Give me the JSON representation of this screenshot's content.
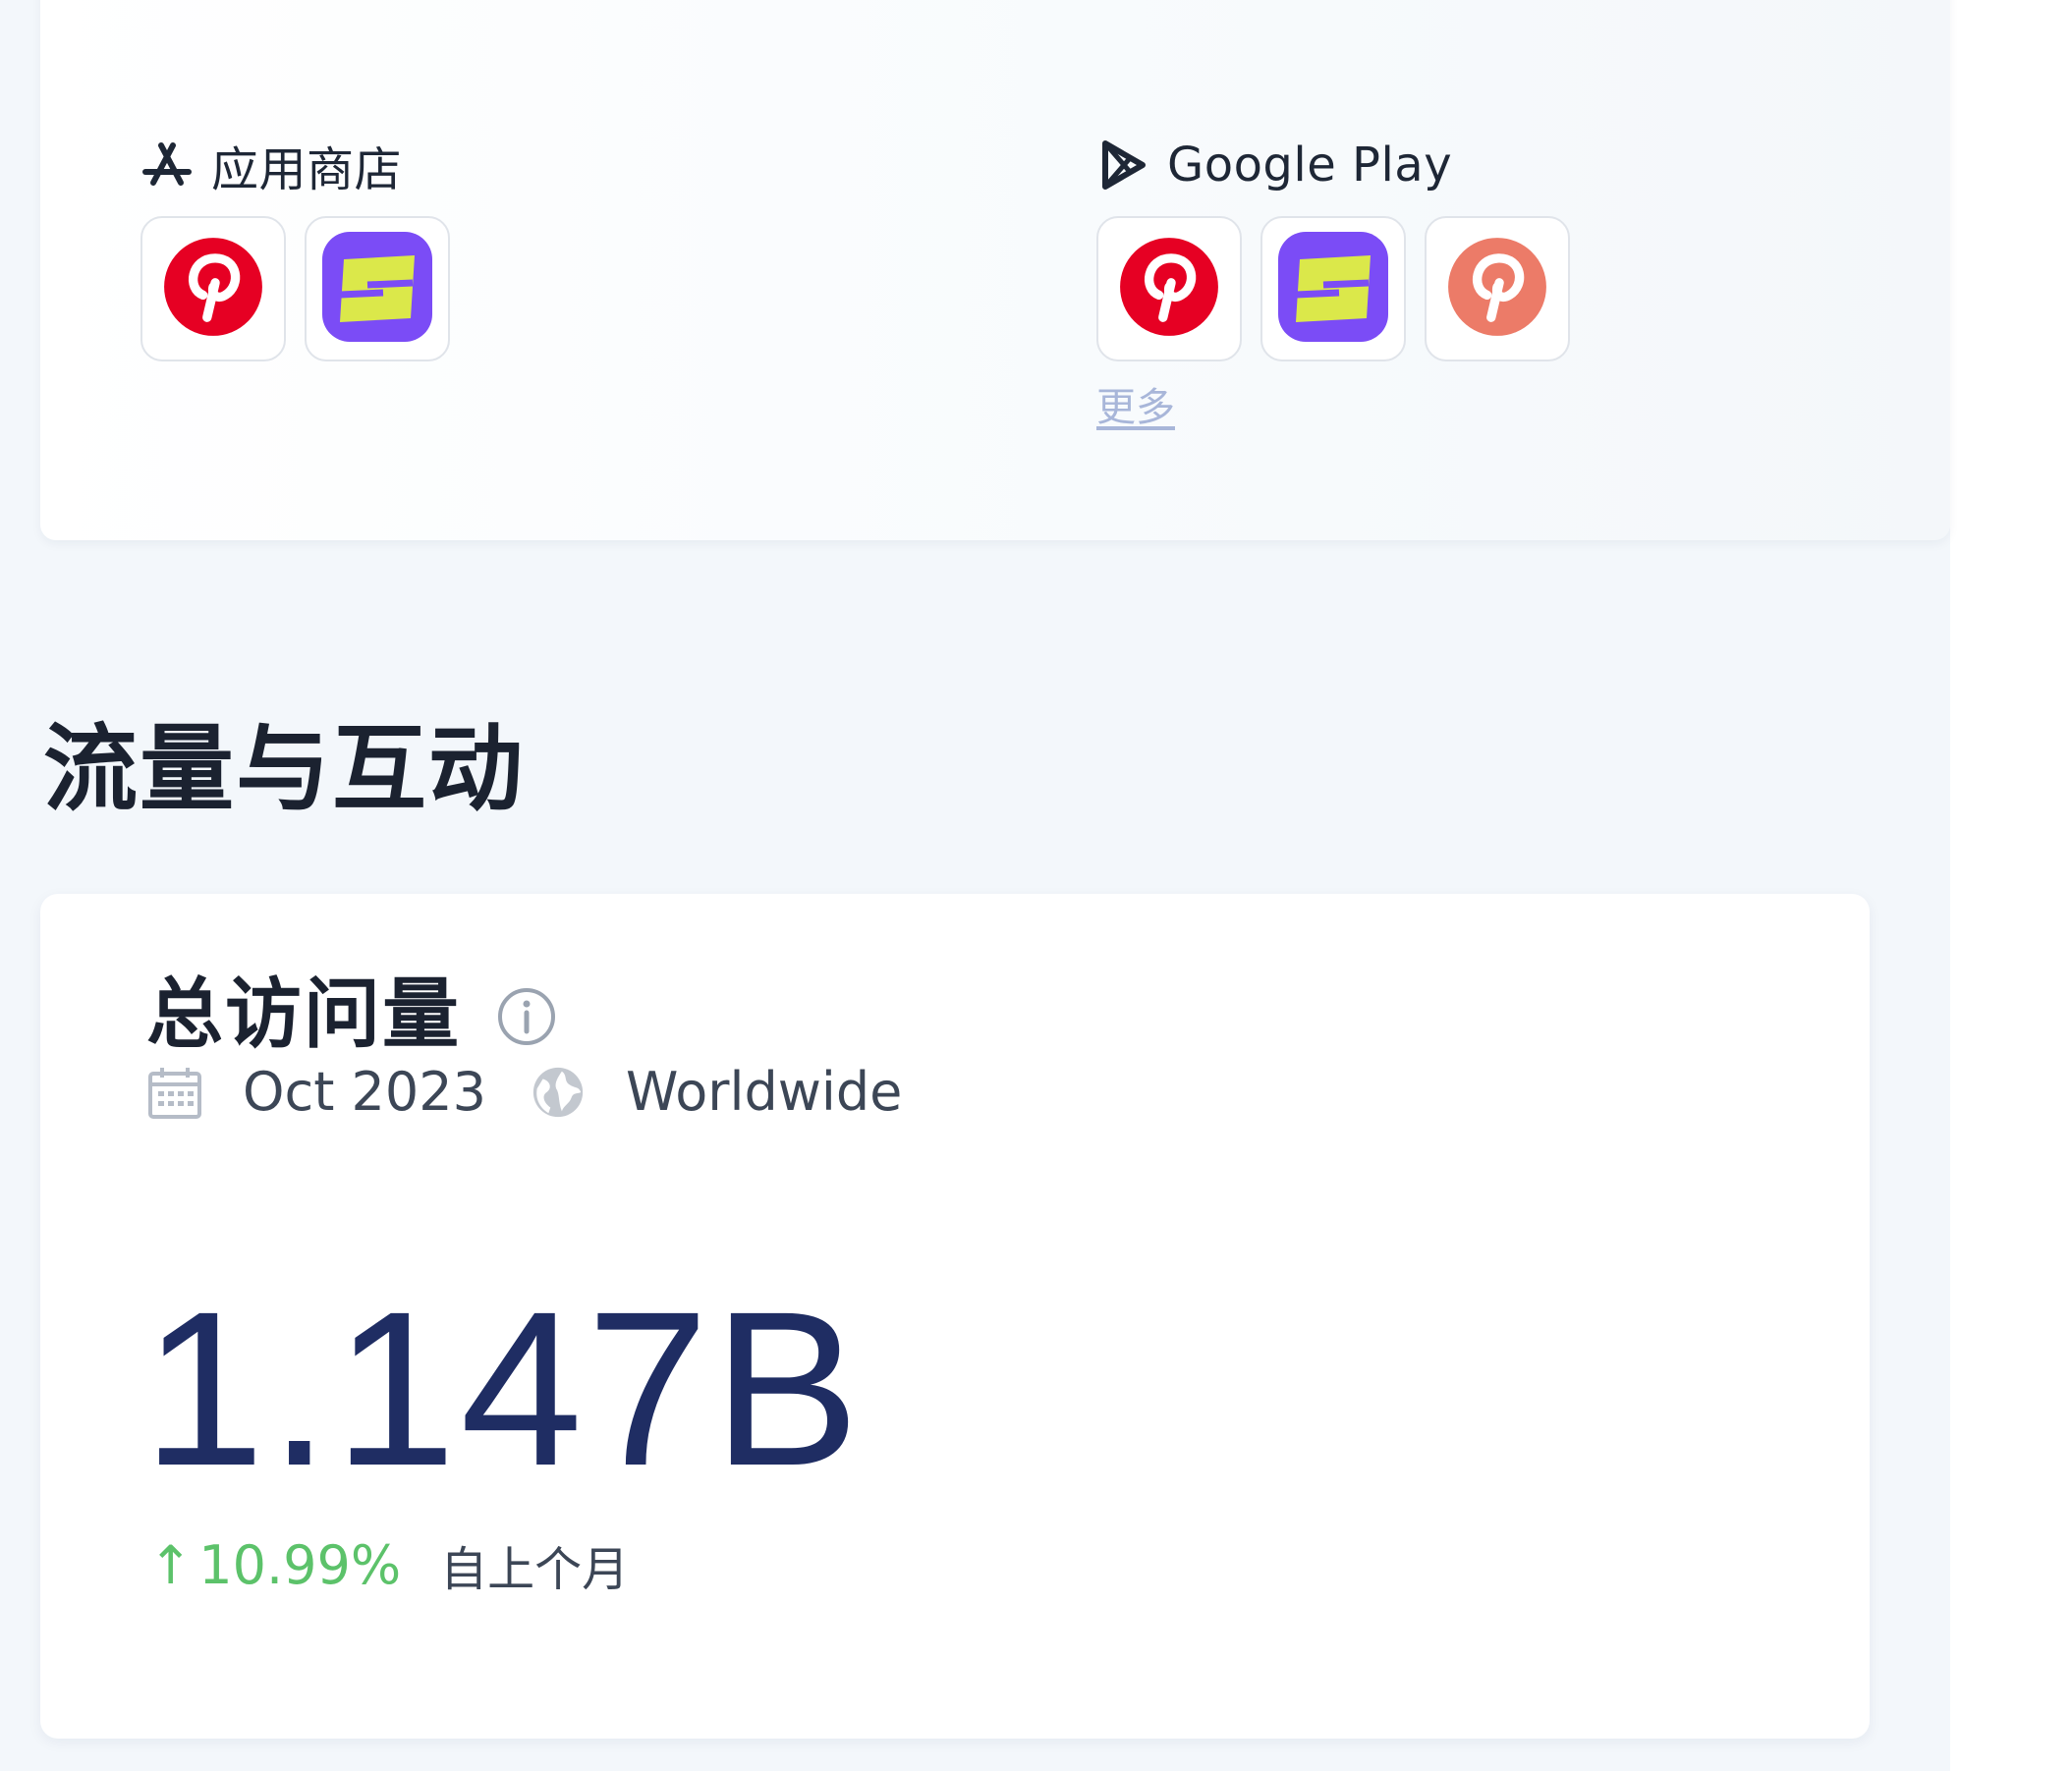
{
  "app_stores": {
    "apple": {
      "label": "应用商店",
      "icon": "app-store-icon",
      "apps": [
        {
          "name": "Pinterest",
          "icon": "pinterest-icon",
          "color": "#e60023"
        },
        {
          "name": "Shuffles",
          "icon": "shuffles-icon",
          "color": "#7b4cf6"
        }
      ]
    },
    "google_play": {
      "label": "Google Play",
      "icon": "google-play-icon",
      "apps": [
        {
          "name": "Pinterest",
          "icon": "pinterest-icon",
          "color": "#e60023"
        },
        {
          "name": "Shuffles",
          "icon": "shuffles-icon",
          "color": "#7b4cf6"
        },
        {
          "name": "Pinterest Lite",
          "icon": "pinterest-lite-icon",
          "color": "#ec7b68"
        }
      ],
      "more_label": "更多"
    }
  },
  "section": {
    "title": "流量与互动"
  },
  "total_visits": {
    "title": "总访问量",
    "info_icon": "info-icon",
    "date": "Oct 2023",
    "date_icon": "calendar-icon",
    "region": "Worldwide",
    "region_icon": "globe-icon",
    "value": "1.147B",
    "change_arrow": "↑",
    "change": "10.99%",
    "change_label": "自上个月",
    "value_color": "#1f2d63",
    "positive_color": "#5cc26a"
  }
}
